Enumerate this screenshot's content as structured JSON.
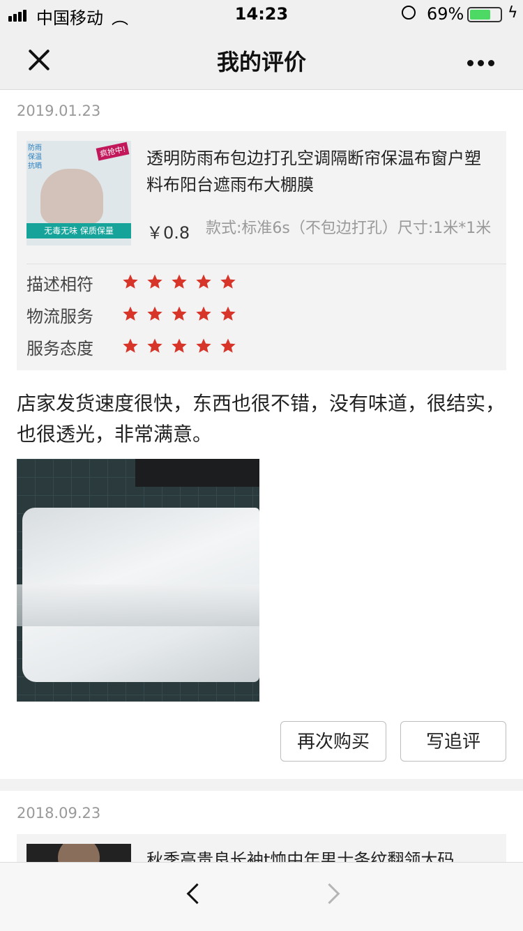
{
  "status_bar": {
    "carrier": "中国移动",
    "time": "14:23",
    "battery_percent": "69%",
    "battery_level": 0.69
  },
  "nav": {
    "title": "我的评价"
  },
  "reviews": [
    {
      "date": "2019.01.23",
      "product": {
        "title": "透明防雨布包边打孔空调隔断帘保温布窗户塑料布阳台遮雨布大棚膜",
        "price": "￥0.8",
        "spec": "款式:标准6s（不包边打孔）尺寸:1米*1米",
        "thumb_texts": {
          "corner": "防雨保温抗晒",
          "badge": "疯抢中!",
          "band": "无毒无味  保质保量"
        }
      },
      "ratings": [
        {
          "label": "描述相符",
          "stars": 5
        },
        {
          "label": "物流服务",
          "stars": 5
        },
        {
          "label": "服务态度",
          "stars": 5
        }
      ],
      "text": "店家发货速度很快，东西也很不错，没有味道，很结实，也很透光，非常满意。",
      "buttons": {
        "rebuy": "再次购买",
        "follow_up": "写追评"
      }
    },
    {
      "date": "2018.09.23",
      "product": {
        "title": "秋季高贵良长袖t恤中年男士条纹翻领大码"
      }
    }
  ],
  "colors": {
    "star": "#d8352a",
    "accent_battery": "#4cd964"
  }
}
